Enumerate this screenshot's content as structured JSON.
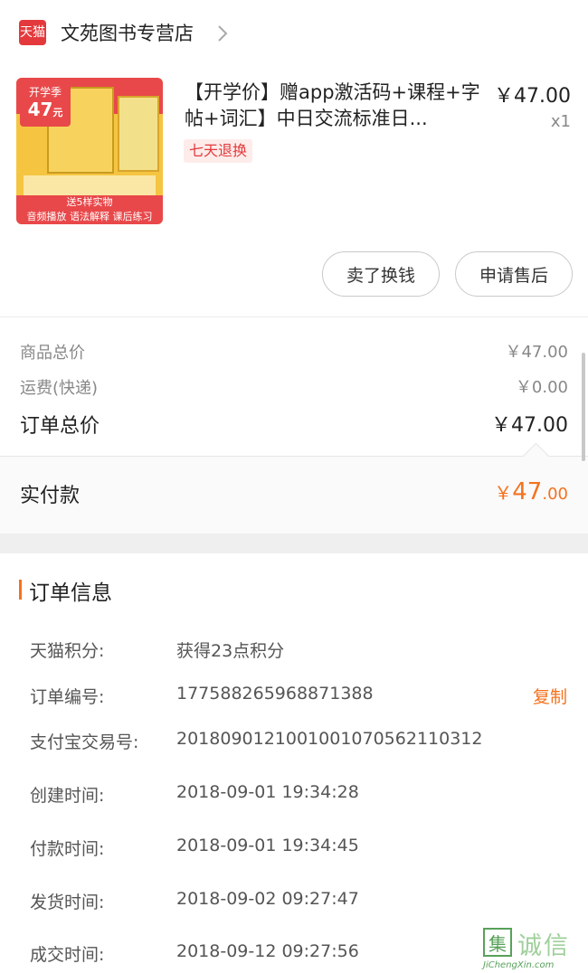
{
  "store": {
    "badge": "天猫",
    "name": "文苑图书专营店"
  },
  "product": {
    "image": {
      "badge_top": "开学季",
      "badge_price": "47",
      "badge_unit": "元",
      "banner": "送5样实物",
      "footer": "音频播放 语法解释 课后练习"
    },
    "title": "【开学价】赠app激活码+课程+字帖+词汇】中日交流标准日...",
    "return_badge": "七天退换",
    "price": "￥47.00",
    "quantity": "x1"
  },
  "actions": {
    "sell": "卖了换钱",
    "after_sale": "申请售后"
  },
  "summary": {
    "goods_total_label": "商品总价",
    "goods_total": "￥47.00",
    "shipping_label": "运费(快递)",
    "shipping": "￥0.00",
    "order_total_label": "订单总价",
    "order_total": "￥47.00"
  },
  "paid": {
    "label": "实付款",
    "currency": "￥",
    "integer": "47",
    "decimal": ".00"
  },
  "order_info": {
    "title": "订单信息",
    "copy_label": "复制",
    "rows": [
      {
        "label": "天猫积分:",
        "value": "获得23点积分"
      },
      {
        "label": "订单编号:",
        "value": "177588265968871388"
      },
      {
        "label": "支付宝交易号:",
        "value": "2018090121001001070562110312"
      },
      {
        "label": "创建时间:",
        "value": "2018-09-01 19:34:28"
      },
      {
        "label": "付款时间:",
        "value": "2018-09-01 19:34:45"
      },
      {
        "label": "发货时间:",
        "value": "2018-09-02 09:27:47"
      },
      {
        "label": "成交时间:",
        "value": "2018-09-12 09:27:56"
      }
    ]
  },
  "watermark": {
    "logo": "集",
    "name": "诚信",
    "url": "JiChengXin.com"
  },
  "colors": {
    "accent": "#f4721e",
    "tmall_red": "#e4393c"
  }
}
